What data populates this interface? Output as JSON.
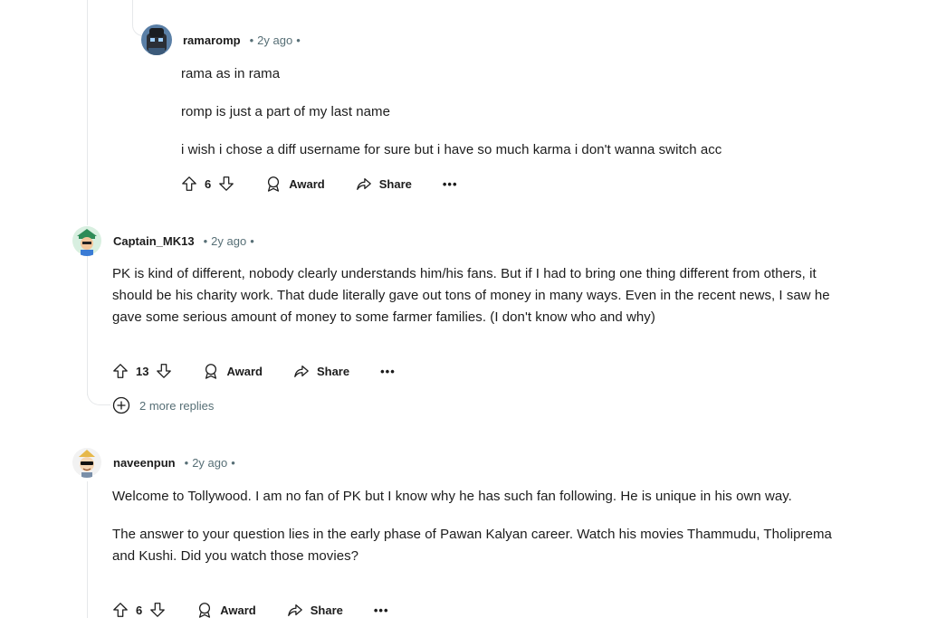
{
  "comments": [
    {
      "username": "ramaromp",
      "time": "2y ago",
      "paragraphs": [
        "rama as in rama",
        "romp is just a part of my last name",
        "i wish i chose a diff username for sure but i have so much karma i don't wanna switch acc"
      ],
      "votes": "6",
      "award_label": "Award",
      "share_label": "Share",
      "more_label": "•••"
    },
    {
      "username": "Captain_MK13",
      "time": "2y ago",
      "paragraphs": [
        "PK is kind of different, nobody clearly understands him/his fans. But if I had to bring one thing different from others, it should be his charity work. That dude literally gave out tons of money in many ways. Even in the recent news, I saw he gave some serious amount of money to some farmer families. (I don't know who and why)"
      ],
      "votes": "13",
      "award_label": "Award",
      "share_label": "Share",
      "more_label": "•••",
      "more_replies": "2 more replies"
    },
    {
      "username": "naveenpun",
      "time": "2y ago",
      "paragraphs": [
        "Welcome to Tollywood. I am no fan of PK but I know why he has such fan following. He is unique in his own way.",
        "The answer to your question lies in the early phase of Pawan Kalyan career. Watch his movies Thammudu, Tholiprema and Kushi. Did you watch those movies?"
      ],
      "votes": "6",
      "award_label": "Award",
      "share_label": "Share",
      "more_label": "•••"
    }
  ],
  "separator": "•",
  "icons": {
    "upvote": "arrow-up-icon",
    "downvote": "arrow-down-icon",
    "award": "award-icon",
    "share": "share-icon",
    "expand": "plus-circle-icon"
  },
  "colors": {
    "text": "#1c1c1c",
    "meta": "#576f76",
    "thread": "#e6e8ea"
  }
}
